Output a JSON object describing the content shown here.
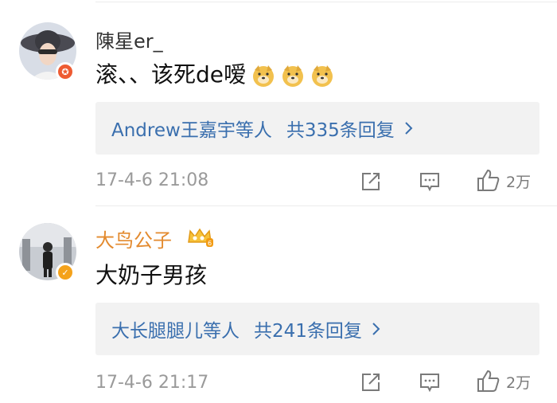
{
  "comments": [
    {
      "username": "陳星er_",
      "username_color": "#333333",
      "text": "滚、、该死de嗳",
      "emoji": [
        "doge-emoji",
        "doge-emoji",
        "doge-emoji"
      ],
      "reply_names": "Andrew王嘉宇等人",
      "reply_count": "共335条回复",
      "date": "17-4-6 21:08",
      "likes": "2万",
      "badge_color": "#ee5b32"
    },
    {
      "username": "大鸟公子",
      "username_color": "#e38a2e",
      "text": "大奶子男孩",
      "reply_names": "大长腿腿儿等人",
      "reply_count": "共241条回复",
      "date": "17-4-6 21:17",
      "likes": "2万",
      "badge_color": "#f4a21b"
    }
  ]
}
